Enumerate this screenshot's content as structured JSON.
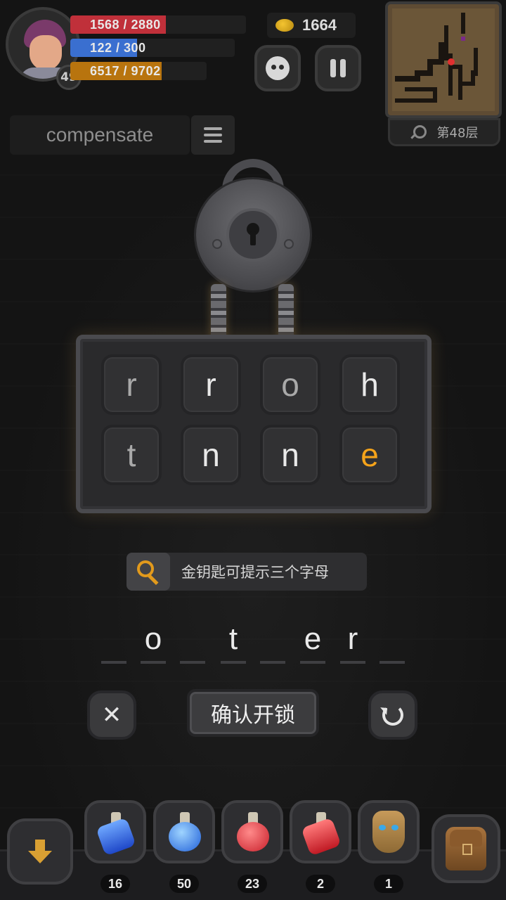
{
  "player": {
    "level": "49",
    "hp": {
      "text": "1568 / 2880",
      "fraction": 0.544
    },
    "mp": {
      "text": "122 / 300",
      "fraction": 0.407
    },
    "xp": {
      "text": "6517 / 9702",
      "fraction": 0.672
    }
  },
  "gold": "1664",
  "floor": "第48层",
  "word": "compensate",
  "lock_letters": [
    "r",
    "r",
    "o",
    "h",
    "t",
    "n",
    "n",
    "e"
  ],
  "hint_text": "金钥匙可提示三个字母",
  "answer_slots": [
    "",
    "o",
    "",
    "t",
    "",
    "e",
    "r",
    ""
  ],
  "buttons": {
    "confirm": "确认开锁",
    "clear": "✕"
  },
  "inventory": {
    "items": [
      {
        "name": "blue-potion",
        "count": "16"
      },
      {
        "name": "blue-orb-potion",
        "count": "50"
      },
      {
        "name": "red-orb-potion",
        "count": "23"
      },
      {
        "name": "red-potion",
        "count": "2"
      },
      {
        "name": "golden-mask",
        "count": "1"
      }
    ]
  },
  "colors": {
    "hp": "#c0303a",
    "mp": "#3a6fd0",
    "xp": "#b8740e",
    "hint_letter": "#f5a31a",
    "accent_key": "#e29a1c"
  }
}
